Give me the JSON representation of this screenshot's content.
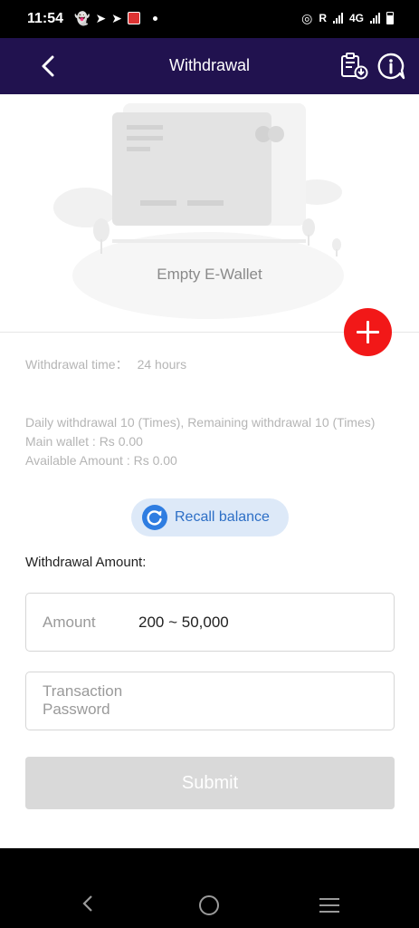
{
  "status_bar": {
    "time": "11:54",
    "network": "R",
    "network_type": "4G"
  },
  "header": {
    "title": "Withdrawal",
    "back_icon": "chevron-left-icon",
    "records_icon": "clipboard-download-icon",
    "info_icon": "info-chat-icon"
  },
  "wallet": {
    "empty_text": "Empty E-Wallet"
  },
  "info": {
    "time_label": "Withdrawal time：",
    "time_value": "24 hours",
    "daily": "Daily withdrawal 10 (Times), Remaining withdrawal 10 (Times)",
    "main_wallet": "Main wallet : Rs 0.00",
    "available_amount": "Available Amount : Rs 0.00"
  },
  "recall": {
    "label": "Recall balance"
  },
  "withdraw": {
    "label": "Withdrawal Amount:",
    "amount_label": "Amount",
    "amount_value": "200 ~ 50,000",
    "password_label": "Transaction Password"
  },
  "submit": {
    "label": "Submit"
  },
  "colors": {
    "header_bg": "#21124f",
    "add_button": "#f21818",
    "recall_bg": "#dde9f8",
    "recall_text": "#2d6fc6",
    "submit_bg": "#d9d9d9"
  }
}
